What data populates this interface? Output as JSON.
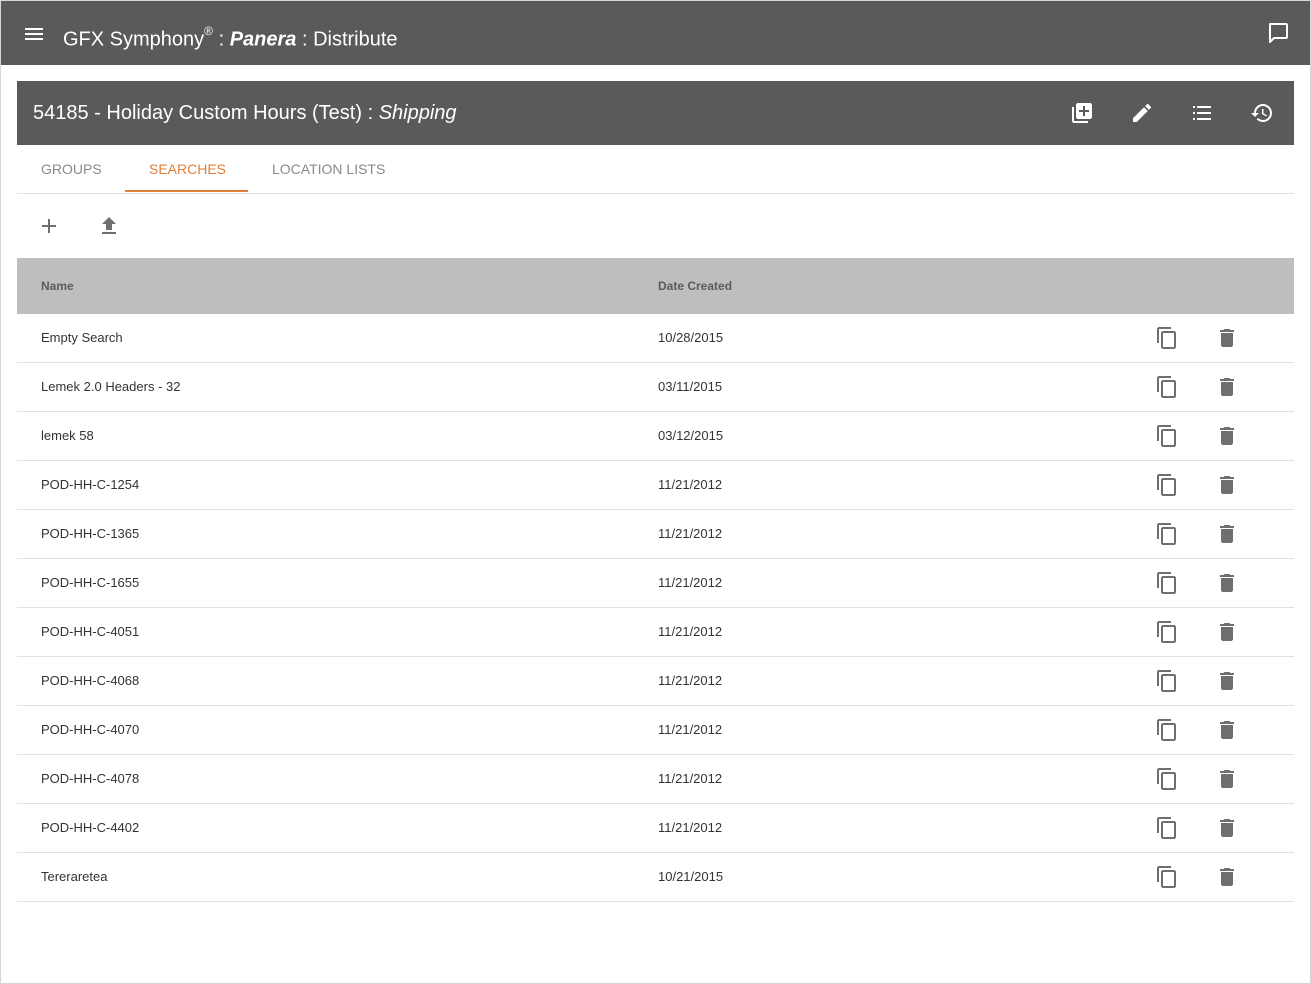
{
  "app": {
    "title_prefix": "GFX Symphony",
    "registered_mark": "®",
    "separator1": " : ",
    "client": "Panera",
    "separator2": " : ",
    "module": "Distribute"
  },
  "header": {
    "title": "54185 - Holiday Custom Hours (Test) : ",
    "department": "Shipping"
  },
  "tabs": [
    {
      "label": "Groups"
    },
    {
      "label": "Searches"
    },
    {
      "label": "Location Lists"
    }
  ],
  "table": {
    "columns": {
      "name": "Name",
      "date": "Date Created"
    },
    "rows": [
      {
        "name": "Empty Search",
        "date": "10/28/2015"
      },
      {
        "name": "Lemek 2.0 Headers - 32",
        "date": "03/11/2015"
      },
      {
        "name": "lemek 58",
        "date": "03/12/2015"
      },
      {
        "name": "POD-HH-C-1254",
        "date": "11/21/2012"
      },
      {
        "name": "POD-HH-C-1365",
        "date": "11/21/2012"
      },
      {
        "name": "POD-HH-C-1655",
        "date": "11/21/2012"
      },
      {
        "name": "POD-HH-C-4051",
        "date": "11/21/2012"
      },
      {
        "name": "POD-HH-C-4068",
        "date": "11/21/2012"
      },
      {
        "name": "POD-HH-C-4070",
        "date": "11/21/2012"
      },
      {
        "name": "POD-HH-C-4078",
        "date": "11/21/2012"
      },
      {
        "name": "POD-HH-C-4402",
        "date": "11/21/2012"
      },
      {
        "name": "Tereraretea",
        "date": "10/21/2015"
      }
    ]
  },
  "colors": {
    "appbar": "#5a5a5b",
    "accent": "#e0803a",
    "table_header": "#bdbebf",
    "icon": "#6f6f6f"
  },
  "icons": {
    "menu": "hamburger-menu-icon",
    "chat": "chat-icon",
    "add_library": "add-to-library-icon",
    "edit": "pencil-icon",
    "list": "list-icon",
    "history": "history-icon",
    "add": "plus-icon",
    "upload": "upload-icon",
    "copy": "copy-icon",
    "delete": "trash-icon"
  }
}
